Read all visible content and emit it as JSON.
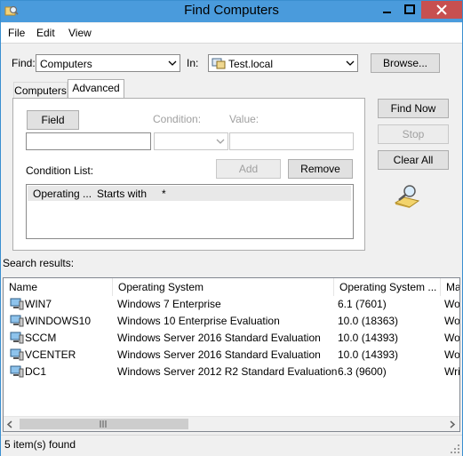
{
  "window": {
    "title": "Find Computers"
  },
  "menu": [
    "File",
    "Edit",
    "View"
  ],
  "find": {
    "label": "Find:",
    "value": "Computers",
    "in_label": "In:",
    "in_value": "Test.local",
    "browse_label": "Browse..."
  },
  "tabs": [
    "Computers",
    "Advanced"
  ],
  "advanced": {
    "field_label": "Field",
    "condition_label": "Condition:",
    "value_label": "Value:",
    "add_label": "Add",
    "remove_label": "Remove",
    "condition_list_label": "Condition List:",
    "conditions": [
      {
        "field": "Operating ...",
        "condition": "Starts with",
        "value": "*"
      }
    ]
  },
  "actions": {
    "find_now": "Find Now",
    "stop": "Stop",
    "clear_all": "Clear All"
  },
  "results": {
    "label": "Search results:",
    "columns": [
      "Name",
      "Operating System",
      "Operating System ...",
      "Ma"
    ],
    "rows": [
      {
        "name": "WIN7",
        "os": "Windows 7 Enterprise",
        "version": "6.1 (7601)",
        "ma": "Wo"
      },
      {
        "name": "WINDOWS10",
        "os": "Windows 10 Enterprise Evaluation",
        "version": "10.0 (18363)",
        "ma": "Wo"
      },
      {
        "name": "SCCM",
        "os": "Windows Server 2016 Standard Evaluation",
        "version": "10.0 (14393)",
        "ma": "Wo"
      },
      {
        "name": "VCENTER",
        "os": "Windows Server 2016 Standard Evaluation",
        "version": "10.0 (14393)",
        "ma": "Wo"
      },
      {
        "name": "DC1",
        "os": "Windows Server 2012 R2 Standard Evaluation",
        "version": "6.3 (9600)",
        "ma": "Wri"
      }
    ]
  },
  "status": {
    "text": "5 item(s) found"
  },
  "colors": {
    "titlebar": "#4a9bdc",
    "close": "#c75050",
    "selected_row": "#e8e8e8"
  }
}
